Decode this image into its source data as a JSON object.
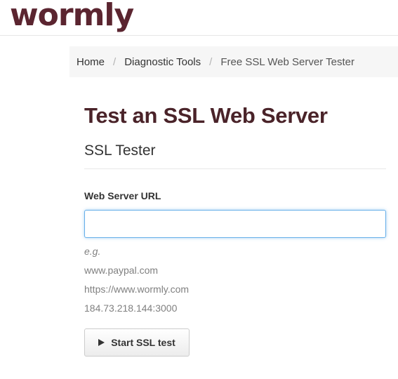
{
  "header": {
    "logo_text": "wormly"
  },
  "breadcrumb": {
    "items": [
      {
        "label": "Home"
      },
      {
        "label": "Diagnostic Tools"
      },
      {
        "label": "Free SSL Web Server Tester"
      }
    ],
    "separator": "/"
  },
  "main": {
    "title": "Test an SSL Web Server",
    "subtitle": "SSL Tester",
    "form": {
      "url_label": "Web Server URL",
      "url_value": "",
      "help_eg": "e.g.",
      "examples": [
        "www.paypal.com",
        "https://www.wormly.com",
        "184.73.218.144:3000"
      ],
      "submit_label": "Start SSL test",
      "submit_icon": "play-icon"
    }
  },
  "colors": {
    "brand": "#5b2530",
    "title": "#4a2329",
    "focus_border": "#66afe9"
  }
}
